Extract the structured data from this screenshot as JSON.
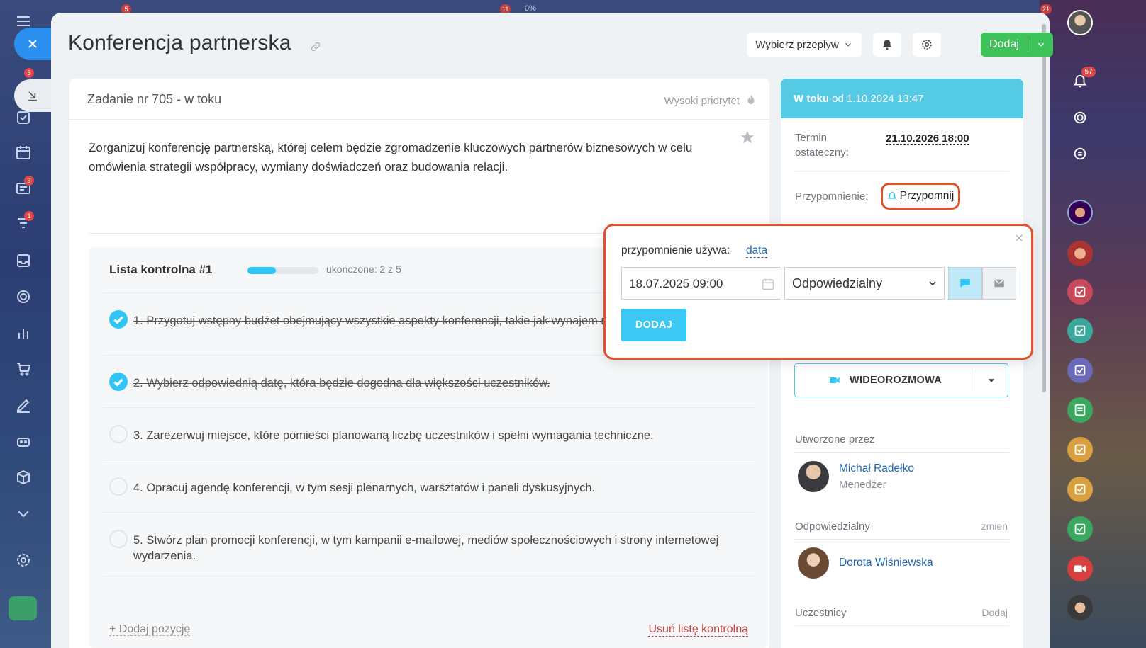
{
  "header": {
    "title": "Konferencja partnerska",
    "flow_select": "Wybierz przepływ",
    "add_label": "Dodaj"
  },
  "left_rail": {
    "badges": [
      "5",
      "3",
      "1"
    ]
  },
  "top_strip": {
    "badges": [
      "5",
      "11",
      "21"
    ],
    "progress_text": "0%"
  },
  "task": {
    "number_status": "Zadanie nr 705 - w toku",
    "priority": "Wysoki priorytet",
    "description": "Zorganizuj konferencję partnerską, której celem będzie zgromadzenie kluczowych partnerów biznesowych w celu omówienia strategii współpracy, wymiany doświadczeń oraz budowania relacji."
  },
  "checklist": {
    "title": "Lista kontrolna #1",
    "progress_fraction": 0.4,
    "progress_text": "ukończone: 2 z 5",
    "items": [
      {
        "text": "1. Przygotuj wstępny budżet obejmujący wszystkie aspekty konferencji, takie jak wynajem materiały promocyjne, itp.",
        "done": true
      },
      {
        "text": "2. Wybierz odpowiednią datę, która będzie dogodna dla większości uczestników.",
        "done": true
      },
      {
        "text": "3. Zarezerwuj miejsce, które pomieści planowaną liczbę uczestników i spełni wymagania techniczne.",
        "done": false
      },
      {
        "text": "4. Opracuj agendę konferencji, w tym sesji plenarnych, warsztatów i paneli dyskusyjnych.",
        "done": false
      },
      {
        "text": "5. Stwórz plan promocji konferencji, w tym kampanii e-mailowej, mediów społecznościowych i strony internetowej wydarzenia.",
        "done": false
      }
    ],
    "add_item": "+ Dodaj pozycję",
    "remove": "Usuń listę kontrolną"
  },
  "side": {
    "status_bold": "W toku",
    "status_rest": "od 1.10.2024 13:47",
    "deadline_label": "Termin ostateczny:",
    "deadline_value": "21.10.2026 18:00",
    "reminder_label": "Przypomnienie:",
    "reminder_link": "Przypomnij",
    "video_call": "WIDEOROZMOWA",
    "created_by_label": "Utworzone przez",
    "creator_name": "Michał Radełko",
    "creator_role": "Menedżer",
    "responsible_label": "Odpowiedzialny",
    "responsible_change": "zmień",
    "responsible_name": "Dorota Wiśniewska",
    "participants_label": "Uczestnicy",
    "participants_add": "Dodaj"
  },
  "reminder_popup": {
    "uses_label": "przypomnienie używa:",
    "uses_link": "data",
    "date_value": "18.07.2025 09:00",
    "recipient_value": "Odpowiedzialny",
    "add_button": "DODAJ"
  },
  "right_rail": {
    "notif_badge": "57"
  },
  "colors": {
    "accent_blue": "#2fc6f6",
    "status_header": "#56cbe6",
    "add_green": "#3ec35a",
    "highlight_red": "#e0522d",
    "link_blue": "#2067b0"
  }
}
